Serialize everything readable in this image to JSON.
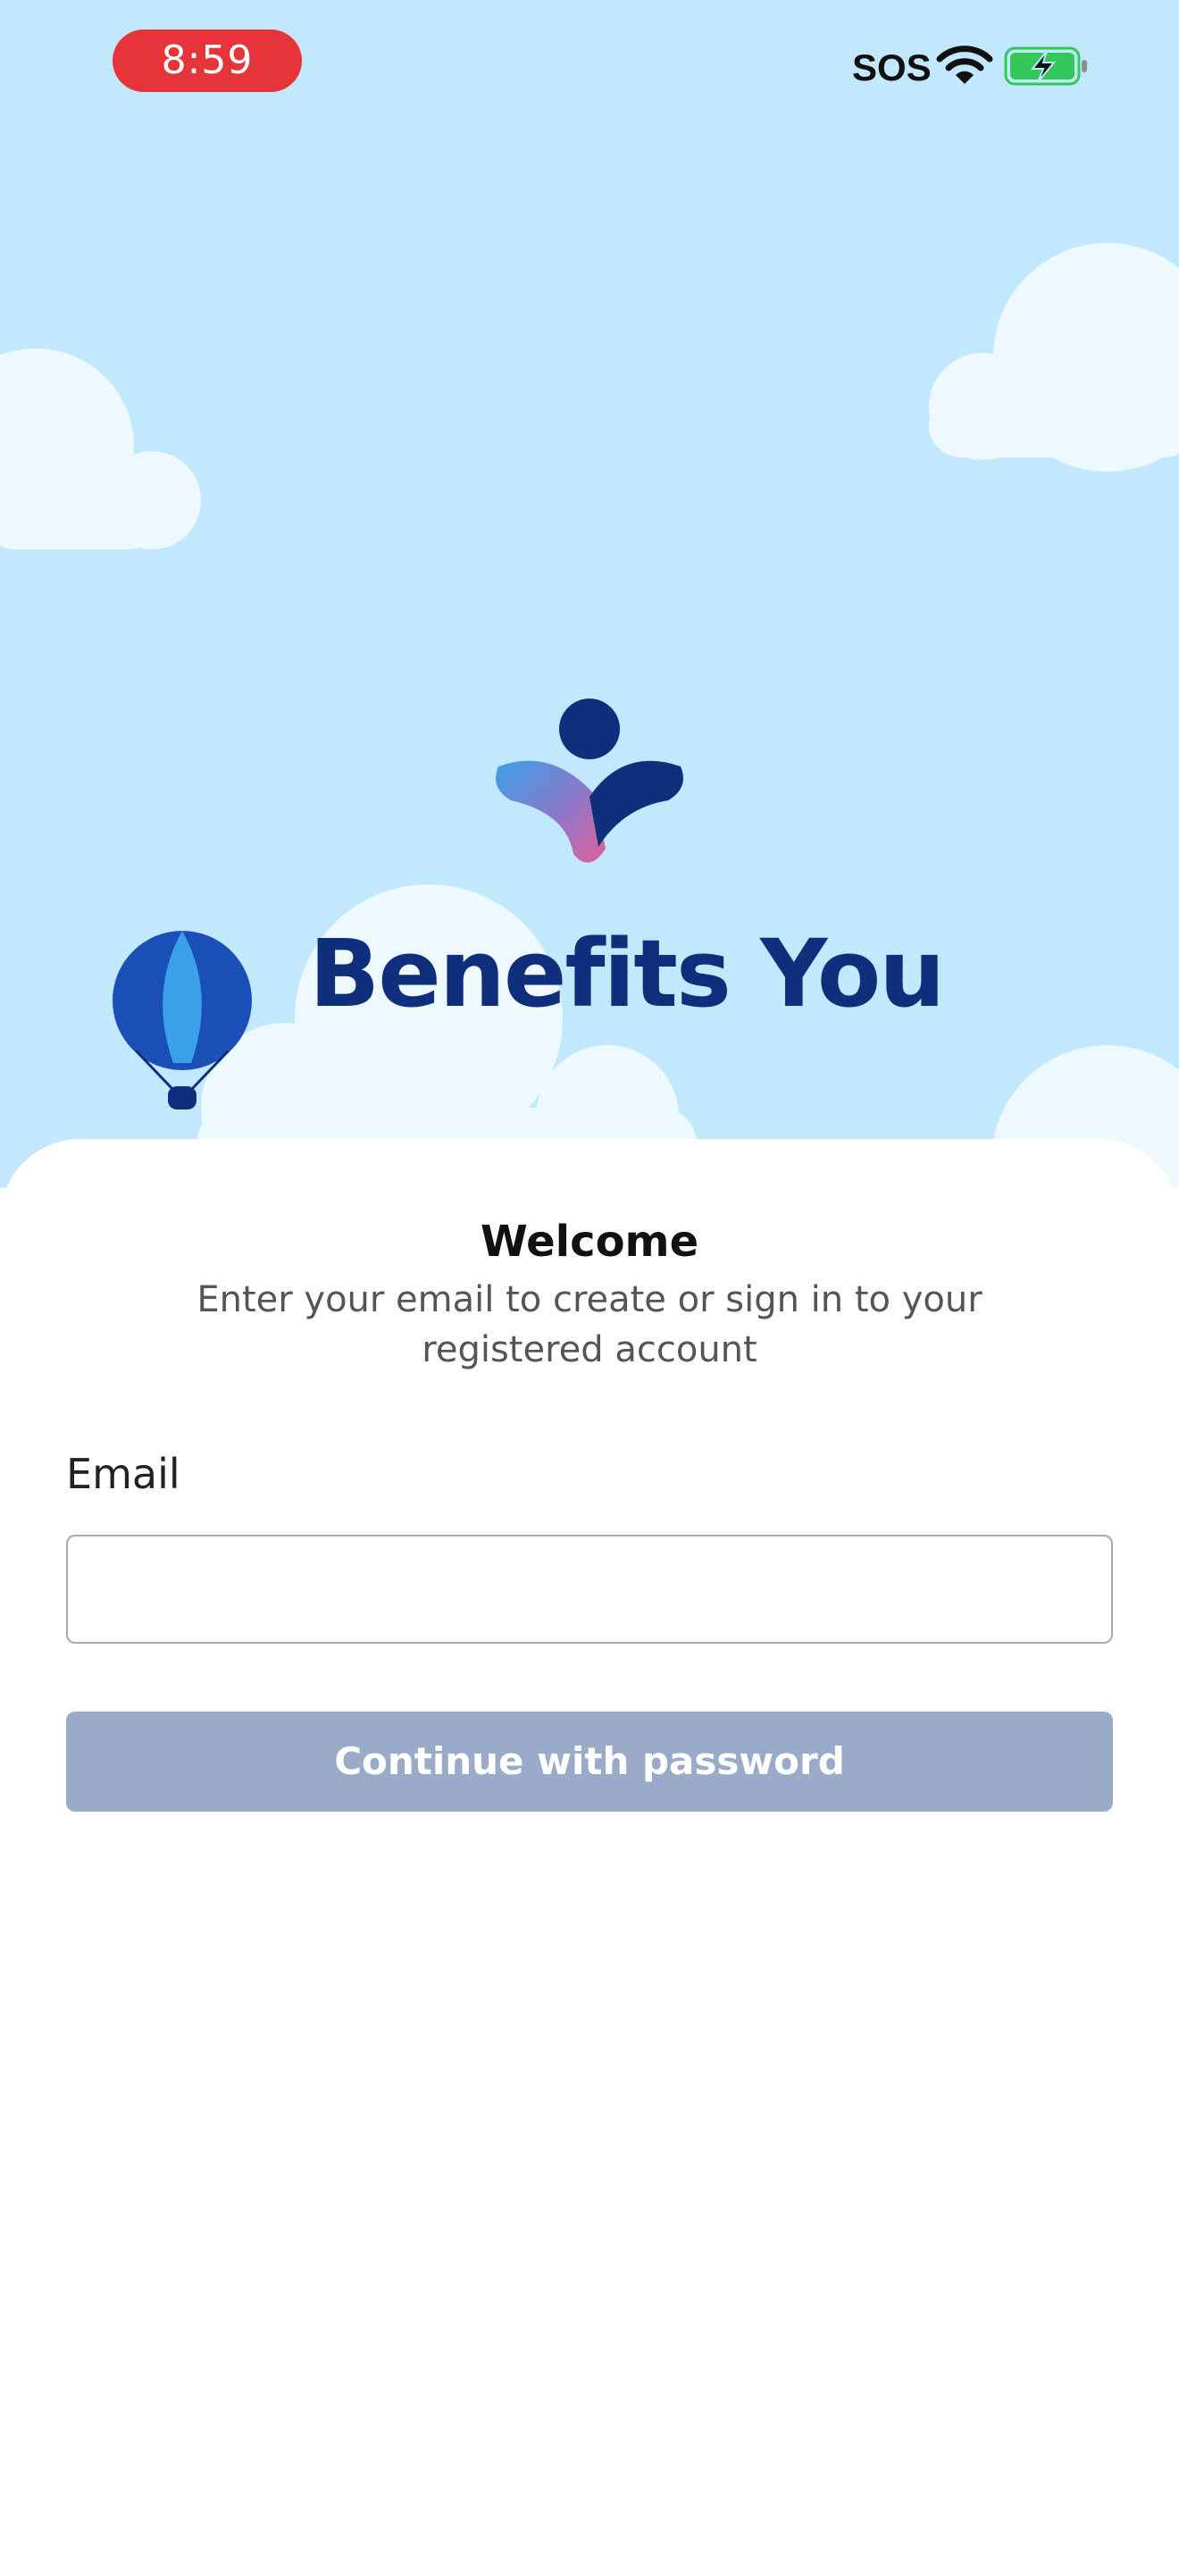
{
  "status_bar": {
    "time": "8:59",
    "sos_label": "SOS",
    "time_pill_color": "#e5353b",
    "wifi_icon": "wifi-icon",
    "battery_icon": "battery-charging-icon"
  },
  "brand": {
    "name": "Benefits You",
    "color": "#0f2f7d",
    "logo_icon": "person-logo-icon",
    "illustration": "hot-air-balloon-icon"
  },
  "welcome": {
    "title": "Welcome",
    "subtitle": "Enter your email to create or sign in to your registered account"
  },
  "form": {
    "email_label": "Email",
    "email_value": "",
    "continue_label": "Continue with password",
    "continue_color": "#9aabca"
  },
  "colors": {
    "sky": "#c1e8fc",
    "cloud": "#eef9ff"
  }
}
